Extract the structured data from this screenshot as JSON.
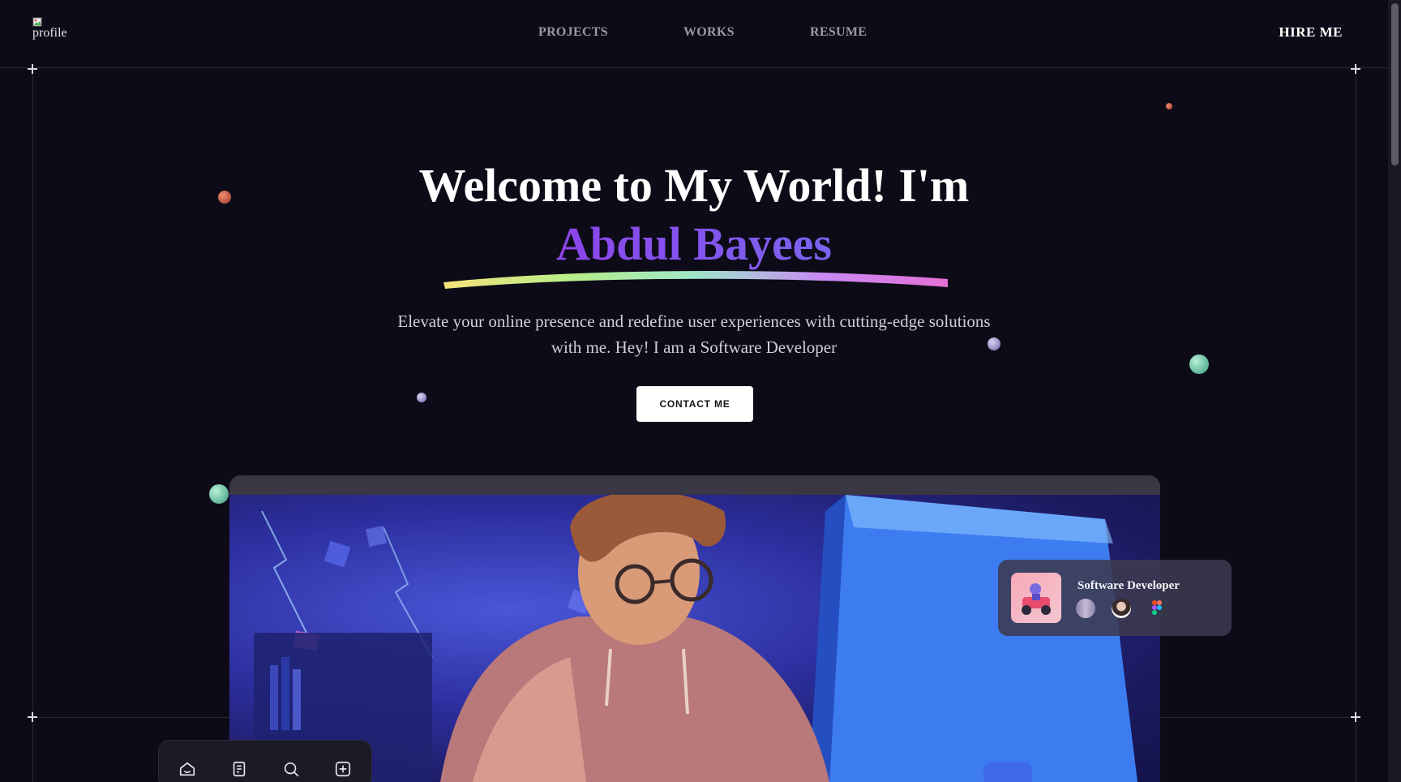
{
  "header": {
    "logo_alt": "profile",
    "nav": [
      {
        "label": "PROJECTS"
      },
      {
        "label": "WORKS"
      },
      {
        "label": "RESUME"
      }
    ],
    "hire_label": "HIRE ME"
  },
  "hero": {
    "title_line1": "Welcome to My World! I'm",
    "title_name": "Abdul Bayees",
    "subtitle": "Elevate your online presence and redefine user experiences with cutting-edge solutions with me. Hey! I am a Software Developer",
    "cta_label": "CONTACT ME"
  },
  "info_card": {
    "title": "Software Developer",
    "avatars": [
      "person-avatar",
      "person-avatar",
      "figma-icon"
    ]
  },
  "toolbar": {
    "icons": [
      "home-icon",
      "document-icon",
      "search-icon",
      "add-icon"
    ]
  },
  "colors": {
    "background": "#0d0b17",
    "accent_purple": "#8e44ec",
    "accent_blue": "#4e8cf2",
    "button_bg": "#ffffff"
  }
}
